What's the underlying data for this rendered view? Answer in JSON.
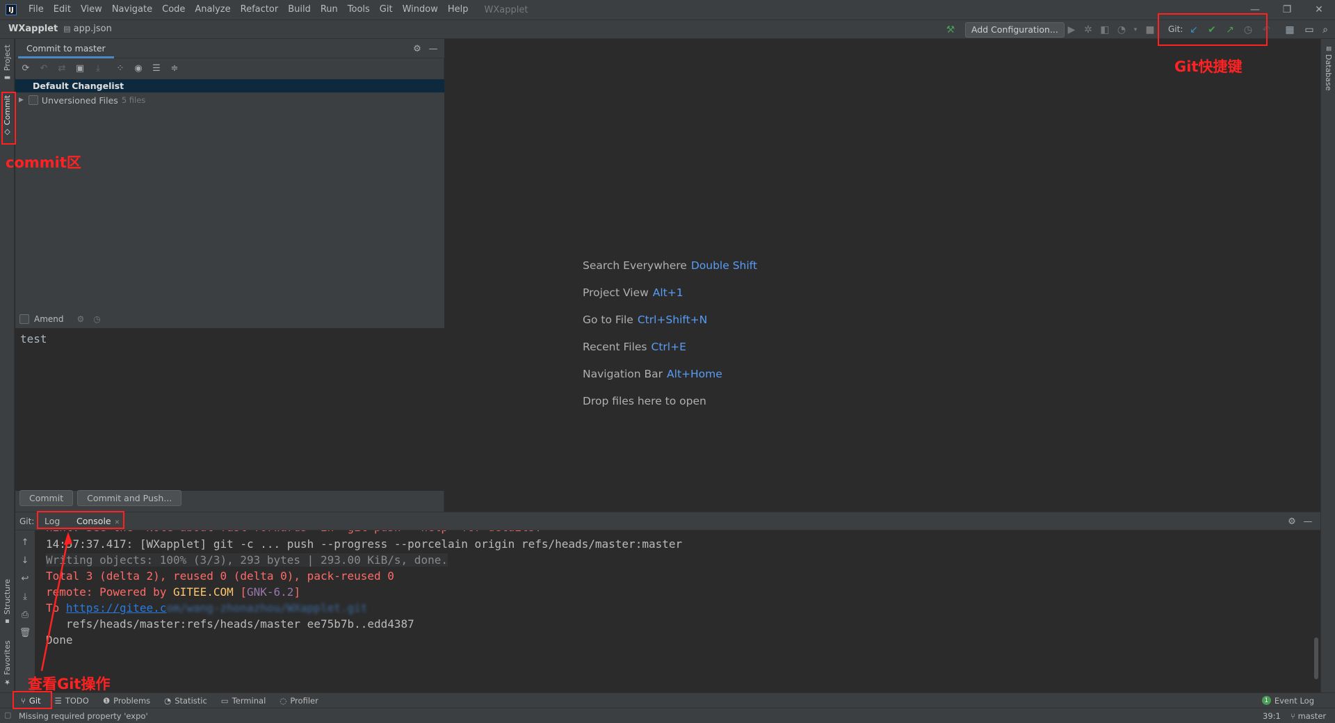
{
  "menubar": {
    "items": [
      "File",
      "Edit",
      "View",
      "Navigate",
      "Code",
      "Analyze",
      "Refactor",
      "Build",
      "Run",
      "Tools",
      "Git",
      "Window",
      "Help"
    ],
    "window_title": "WXapplet"
  },
  "navbar": {
    "project": "WXapplet",
    "file": "app.json",
    "add_configuration": "Add Configuration...",
    "git_label": "Git:"
  },
  "left_stripe": {
    "project": "Project",
    "commit": "Commit",
    "structure": "Structure",
    "favorites": "Favorites"
  },
  "right_stripe": {
    "database": "Database"
  },
  "commit_panel": {
    "tab_title": "Commit to master",
    "default_changelist": "Default Changelist",
    "unversioned_label": "Unversioned Files",
    "unversioned_count": "5 files",
    "amend_label": "Amend",
    "message": "test",
    "commit_button": "Commit",
    "commit_push_button": "Commit and Push..."
  },
  "editor_hints": [
    {
      "text": "Search Everywhere",
      "key": "Double Shift"
    },
    {
      "text": "Project View",
      "key": "Alt+1"
    },
    {
      "text": "Go to File",
      "key": "Ctrl+Shift+N"
    },
    {
      "text": "Recent Files",
      "key": "Ctrl+E"
    },
    {
      "text": "Navigation Bar",
      "key": "Alt+Home"
    },
    {
      "text": "Drop files here to open",
      "key": ""
    }
  ],
  "git_window": {
    "label": "Git:",
    "tabs": [
      "Log",
      "Console"
    ],
    "console": {
      "line0": "hint: See the 'Note about fast-forwards' in 'git push --help' for details.",
      "line1": "14:57:37.417: [WXapplet] git -c ... push --progress --porcelain origin refs/heads/master:master",
      "line2": "Writing objects: 100% (3/3), 293 bytes | 293.00 KiB/s, done.",
      "line3": "Total 3 (delta 2), reused 0 (delta 0), pack-reused 0",
      "line4_prefix": "remote: Powered by ",
      "line4_gitee": "GITEE.COM",
      "line4_bracket_open": " [",
      "line4_gnk": "GNK-6.2",
      "line4_bracket_close": "]",
      "line5_prefix": "To ",
      "line5_link": "https://gitee.c",
      "line5_blurred": "om/wang-zhonazhou/WXapplet.git",
      "line6": "   refs/heads/master:refs/heads/master ee75b7b..edd4387",
      "line7": "Done"
    }
  },
  "bottom_bar": {
    "git": "Git",
    "todo": "TODO",
    "problems": "Problems",
    "statistic": "Statistic",
    "terminal": "Terminal",
    "profiler": "Profiler",
    "event_log": "Event Log",
    "event_log_count": "1"
  },
  "status_bar": {
    "message": "Missing required property 'expo'",
    "position": "39:1",
    "branch": "master"
  },
  "annotations": {
    "commit_area": "commit区",
    "git_shortcuts": "Git快捷键",
    "view_git_ops": "查看Git操作"
  },
  "colors": {
    "annotation_red": "#ff2222",
    "link_blue": "#589df6",
    "console_red": "#ff6b68",
    "selection": "#0d293e",
    "git_update": "#3592c4",
    "git_commit": "#499c54",
    "git_push": "#499c54"
  },
  "icons": [
    "refresh-icon",
    "rollback-icon",
    "show-diff-icon",
    "shelve-icon",
    "group-by-icon",
    "eye-icon",
    "expand-all-icon",
    "collapse-all-icon",
    "gear-icon",
    "minimize-icon",
    "hammer-icon",
    "run-icon",
    "debug-icon",
    "coverage-icon",
    "profile-icon",
    "stop-icon",
    "git-update-icon",
    "git-commit-icon",
    "git-push-icon",
    "git-history-icon",
    "git-rollback-icon",
    "project-structure-icon",
    "layout-icon",
    "search-icon"
  ]
}
